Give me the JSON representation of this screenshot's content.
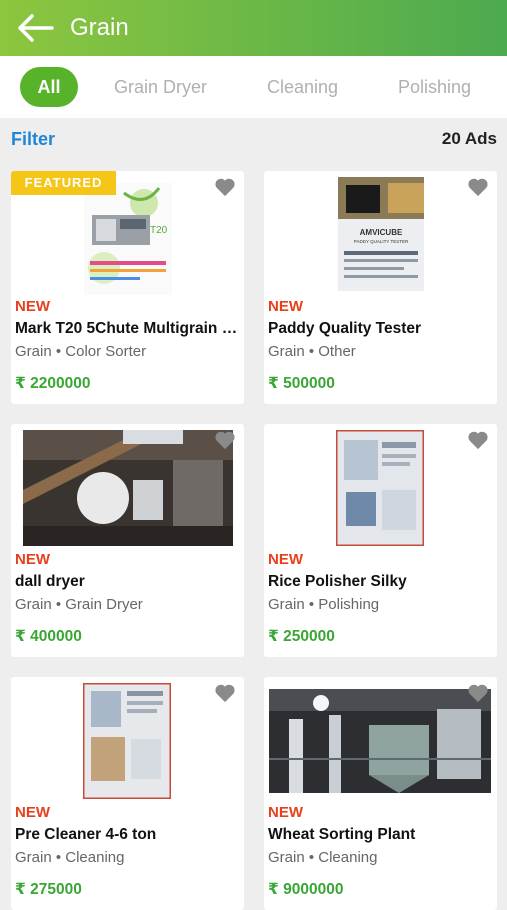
{
  "header": {
    "title": "Grain",
    "back_icon": "arrow-left-icon"
  },
  "tabs": [
    {
      "label": "All",
      "active": true
    },
    {
      "label": "Grain Dryer",
      "active": false
    },
    {
      "label": "Cleaning",
      "active": false
    },
    {
      "label": "Polishing",
      "active": false
    }
  ],
  "filterbar": {
    "filter_label": "Filter",
    "count_label": "20 Ads"
  },
  "colors": {
    "accent": "#59b32a",
    "new": "#e8401c",
    "price": "#3aa635",
    "featured": "#f5c518",
    "link": "#1f86d6"
  },
  "listings": [
    {
      "featured_label": "FEATURED",
      "new_label": "NEW",
      "title": "Mark T20 5Chute Multigrain So...",
      "meta": "Grain • Color Sorter",
      "price": "₹ 2200000",
      "favorite_icon": "heart-icon"
    },
    {
      "new_label": "NEW",
      "title": "Paddy Quality Tester",
      "meta": "Grain • Other",
      "price": "₹ 500000",
      "favorite_icon": "heart-icon",
      "image_brand": "AMVICUBE",
      "image_sub": "PADDY QUALITY TESTER"
    },
    {
      "new_label": "NEW",
      "title": "dall dryer",
      "meta": "Grain • Grain Dryer",
      "price": "₹ 400000",
      "favorite_icon": "heart-icon"
    },
    {
      "new_label": "NEW",
      "title": "Rice Polisher Silky",
      "meta": "Grain • Polishing",
      "price": "₹ 250000",
      "favorite_icon": "heart-icon"
    },
    {
      "new_label": "NEW",
      "title": "Pre Cleaner 4-6 ton",
      "meta": "Grain • Cleaning",
      "price": "₹ 275000",
      "favorite_icon": "heart-icon"
    },
    {
      "new_label": "NEW",
      "title": "Wheat Sorting Plant",
      "meta": "Grain • Cleaning",
      "price": "₹ 9000000",
      "favorite_icon": "heart-icon"
    }
  ]
}
